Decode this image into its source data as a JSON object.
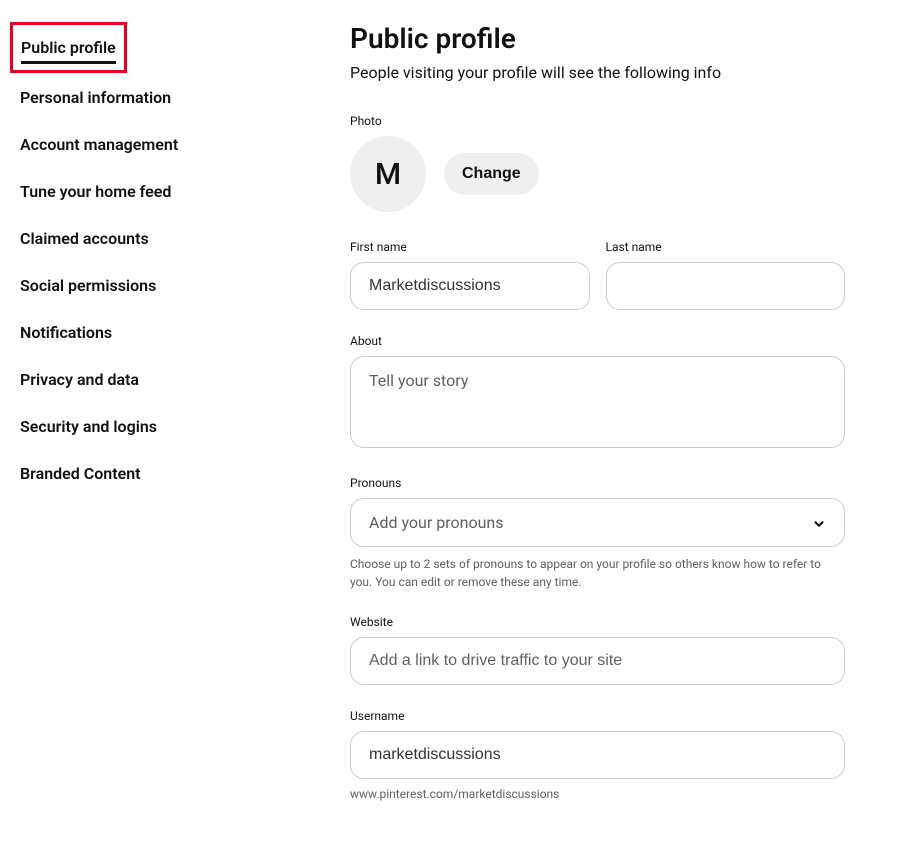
{
  "sidebar": {
    "items": [
      {
        "label": "Public profile",
        "active": true
      },
      {
        "label": "Personal information"
      },
      {
        "label": "Account management"
      },
      {
        "label": "Tune your home feed"
      },
      {
        "label": "Claimed accounts"
      },
      {
        "label": "Social permissions"
      },
      {
        "label": "Notifications"
      },
      {
        "label": "Privacy and data"
      },
      {
        "label": "Security and logins"
      },
      {
        "label": "Branded Content"
      }
    ]
  },
  "main": {
    "title": "Public profile",
    "subtitle": "People visiting your profile will see the following info",
    "photo": {
      "label": "Photo",
      "initial": "M",
      "change_button": "Change"
    },
    "first_name": {
      "label": "First name",
      "value": "Marketdiscussions"
    },
    "last_name": {
      "label": "Last name",
      "value": ""
    },
    "about": {
      "label": "About",
      "placeholder": "Tell your story"
    },
    "pronouns": {
      "label": "Pronouns",
      "placeholder": "Add your pronouns",
      "help": "Choose up to 2 sets of pronouns to appear on your profile so others know how to refer to you. You can edit or remove these any time."
    },
    "website": {
      "label": "Website",
      "placeholder": "Add a link to drive traffic to your site"
    },
    "username": {
      "label": "Username",
      "value": "marketdiscussions",
      "url": "www.pinterest.com/marketdiscussions"
    }
  }
}
